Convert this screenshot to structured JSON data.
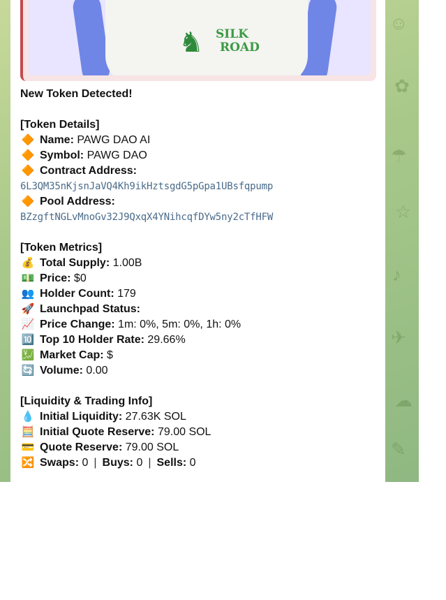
{
  "media": {
    "logo_text_line1": "SILK",
    "logo_text_line2": "ROAD"
  },
  "message": {
    "title": "New Token Detected!",
    "token_details": {
      "header": "[Token Details]",
      "name_label": "Name:",
      "name_value": "PAWG DAO AI",
      "symbol_label": "Symbol:",
      "symbol_value": "PAWG DAO",
      "contract_label": "Contract Address:",
      "contract_value": "6L3QM35nKjsnJaVQ4Kh9ikHztsgdG5pGpa1UBsfqpump",
      "pool_label": "Pool Address:",
      "pool_value": "BZzgftNGLvMnoGv32J9QxqX4YNihcqfDYw5ny2cTfHFW"
    },
    "token_metrics": {
      "header": "[Token Metrics]",
      "supply_label": "Total Supply:",
      "supply_value": "1.00B",
      "price_label": "Price:",
      "price_value": "$0",
      "holders_label": "Holder Count:",
      "holders_value": "179",
      "launchpad_label": "Launchpad Status:",
      "launchpad_value": "",
      "change_label": "Price Change:",
      "change_value": "1m: 0%, 5m: 0%, 1h: 0%",
      "top10_label": "Top 10 Holder Rate:",
      "top10_value": "29.66%",
      "mcap_label": "Market Cap:",
      "mcap_value": "$",
      "volume_label": "Volume:",
      "volume_value": "0.00"
    },
    "liquidity": {
      "header": "[Liquidity & Trading Info]",
      "init_liq_label": "Initial Liquidity:",
      "init_liq_value": "27.63K SOL",
      "init_quote_label": "Initial Quote Reserve:",
      "init_quote_value": "79.00 SOL",
      "quote_label": "Quote Reserve:",
      "quote_value": "79.00 SOL",
      "swaps_label": "Swaps:",
      "swaps_value": "0",
      "buys_label": "Buys:",
      "buys_value": "0",
      "sells_label": "Sells:",
      "sells_value": "0",
      "separator": "|"
    }
  },
  "icons": {
    "diamond": "🔶",
    "money_bag": "💰",
    "dollar": "💵",
    "holders": "👥",
    "rocket": "🚀",
    "chart_up": "📈",
    "ten": "🔟",
    "yen_chart": "💹",
    "refresh": "🔄",
    "droplet": "💧",
    "abacus": "🧮",
    "card": "💳",
    "shuffle": "🔀"
  },
  "colors": {
    "accent_bar": "#c64a4a",
    "address_text": "#4a6b8a",
    "chat_bg": "#a9c98a"
  }
}
